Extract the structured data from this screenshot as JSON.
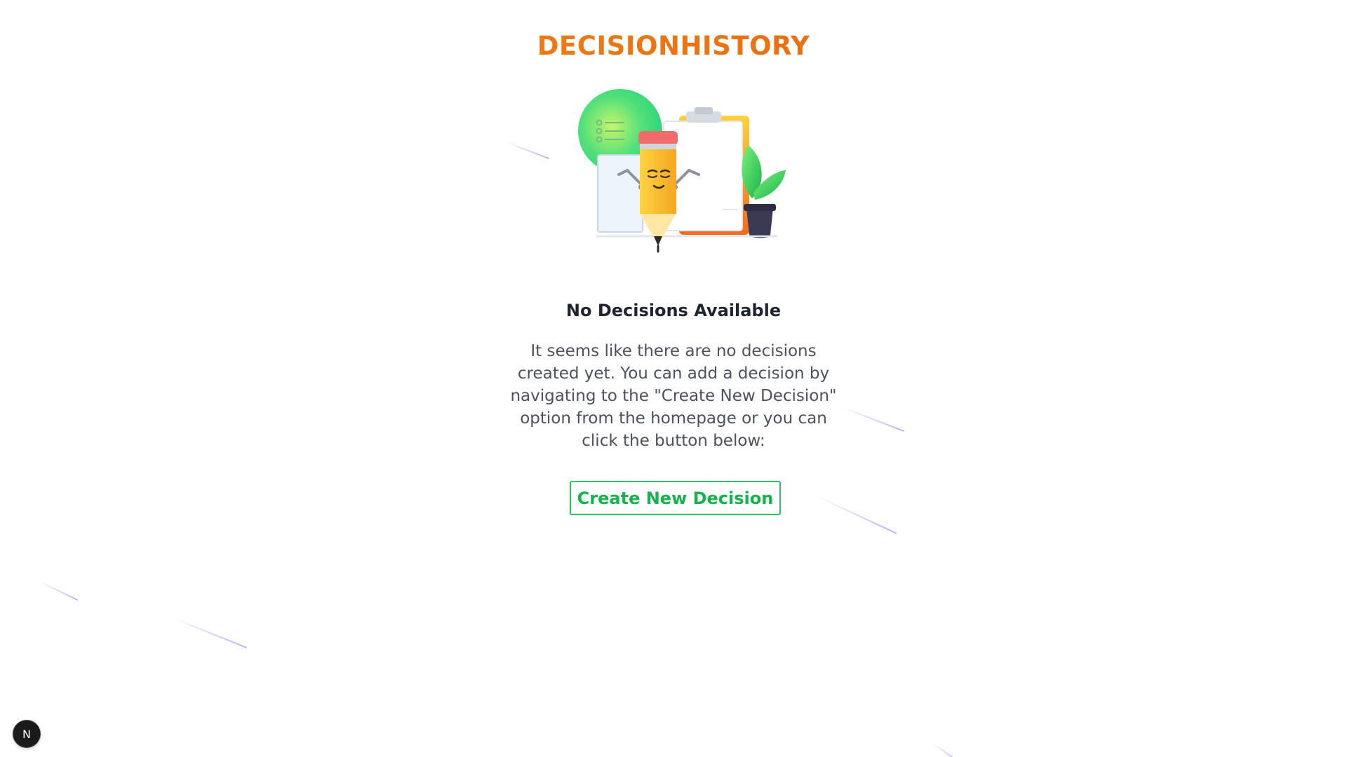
{
  "header": {
    "title": "DECISIONHISTORY"
  },
  "illustration": {
    "icon": "pencil-clipboard-illustration"
  },
  "empty_state": {
    "title": "No Decisions Available",
    "message": "It seems like there are no decisions created yet. You can add a decision by navigating to the \"Create New Decision\" option from the homepage or you can click the button below:",
    "button_label": "Create New Decision"
  },
  "dev_badge": {
    "label": "N"
  },
  "colors": {
    "title_gradient_start": "#f5891a",
    "title_gradient_end": "#e3600c",
    "button_accent": "#22c55e",
    "heading_text": "#1e2430",
    "body_text": "#4b5160"
  }
}
